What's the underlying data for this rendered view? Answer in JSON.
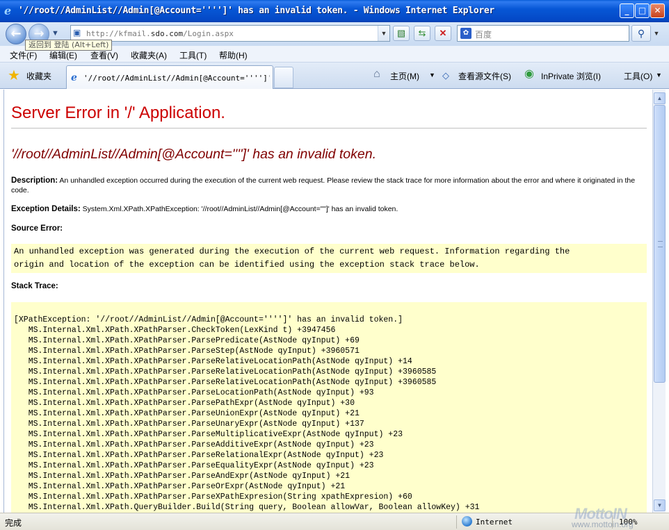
{
  "window": {
    "title": "'//root//AdminList//Admin[@Account='''']' has an invalid token. - Windows Internet Explorer",
    "min": "_",
    "max": "□",
    "close": "✕"
  },
  "nav": {
    "url_prefix": "http://kfmail.",
    "url_domain": "sdo.com",
    "url_suffix": "/Login.aspx",
    "search_placeholder": "百度",
    "back_tooltip": "返回到 登陆 (Alt+Left)"
  },
  "menu": [
    {
      "label": "文件(F)"
    },
    {
      "label": "编辑(E)"
    },
    {
      "label": "查看(V)"
    },
    {
      "label": "收藏夹(A)"
    },
    {
      "label": "工具(T)"
    },
    {
      "label": "帮助(H)"
    }
  ],
  "tabs": {
    "favorites": "收藏夹",
    "active_tab_title": "'//root//AdminList//Admin[@Account='''']'...",
    "commands": {
      "home": "主页(M)",
      "view_source": "查看源文件(S)",
      "inprivate": "InPrivate 浏览(I)",
      "tools": "工具(O)"
    }
  },
  "page": {
    "heading": "Server Error in '/' Application.",
    "error_title": "'//root//AdminList//Admin[@Account='''']' has an invalid token.",
    "description_label": "Description:",
    "description_text": " An unhandled exception occurred during the execution of the current web request. Please review the stack trace for more information about the error and where it originated in the code.",
    "exception_label": "Exception Details:",
    "exception_text": " System.Xml.XPath.XPathException: '//root//AdminList//Admin[@Account='''']' has an invalid token.",
    "source_error_label": "Source Error:",
    "source_error_lines": [
      "An unhandled exception was generated during the execution of the current web request. Information regarding the",
      "origin and location of the exception can be identified using the exception stack trace below."
    ],
    "stack_trace_label": "Stack Trace:",
    "stack_trace_lines": [
      "[XPathException: '//root//AdminList//Admin[@Account='''']' has an invalid token.]",
      "   MS.Internal.Xml.XPath.XPathParser.CheckToken(LexKind t) +3947456",
      "   MS.Internal.Xml.XPath.XPathParser.ParsePredicate(AstNode qyInput) +69",
      "   MS.Internal.Xml.XPath.XPathParser.ParseStep(AstNode qyInput) +3960571",
      "   MS.Internal.Xml.XPath.XPathParser.ParseRelativeLocationPath(AstNode qyInput) +14",
      "   MS.Internal.Xml.XPath.XPathParser.ParseRelativeLocationPath(AstNode qyInput) +3960585",
      "   MS.Internal.Xml.XPath.XPathParser.ParseRelativeLocationPath(AstNode qyInput) +3960585",
      "   MS.Internal.Xml.XPath.XPathParser.ParseLocationPath(AstNode qyInput) +93",
      "   MS.Internal.Xml.XPath.XPathParser.ParsePathExpr(AstNode qyInput) +30",
      "   MS.Internal.Xml.XPath.XPathParser.ParseUnionExpr(AstNode qyInput) +21",
      "   MS.Internal.Xml.XPath.XPathParser.ParseUnaryExpr(AstNode qyInput) +137",
      "   MS.Internal.Xml.XPath.XPathParser.ParseMultiplicativeExpr(AstNode qyInput) +23",
      "   MS.Internal.Xml.XPath.XPathParser.ParseAdditiveExpr(AstNode qyInput) +23",
      "   MS.Internal.Xml.XPath.XPathParser.ParseRelationalExpr(AstNode qyInput) +23",
      "   MS.Internal.Xml.XPath.XPathParser.ParseEqualityExpr(AstNode qyInput) +23",
      "   MS.Internal.Xml.XPath.XPathParser.ParseAndExpr(AstNode qyInput) +21",
      "   MS.Internal.Xml.XPath.XPathParser.ParseOrExpr(AstNode qyInput) +21",
      "   MS.Internal.Xml.XPath.XPathParser.ParseXPathExpresion(String xpathExpresion) +60",
      "   MS.Internal.Xml.XPath.QueryBuilder.Build(String query, Boolean allowVar, Boolean allowKey) +31"
    ]
  },
  "status": {
    "text": "完成",
    "zone": "Internet",
    "zoom": "100%"
  },
  "watermark": {
    "logo": "MottoIN",
    "url": "www.mottoin.org"
  },
  "colors": {
    "heading": "#cc0000",
    "error_title": "#800000",
    "code_background": "#ffffcc"
  }
}
